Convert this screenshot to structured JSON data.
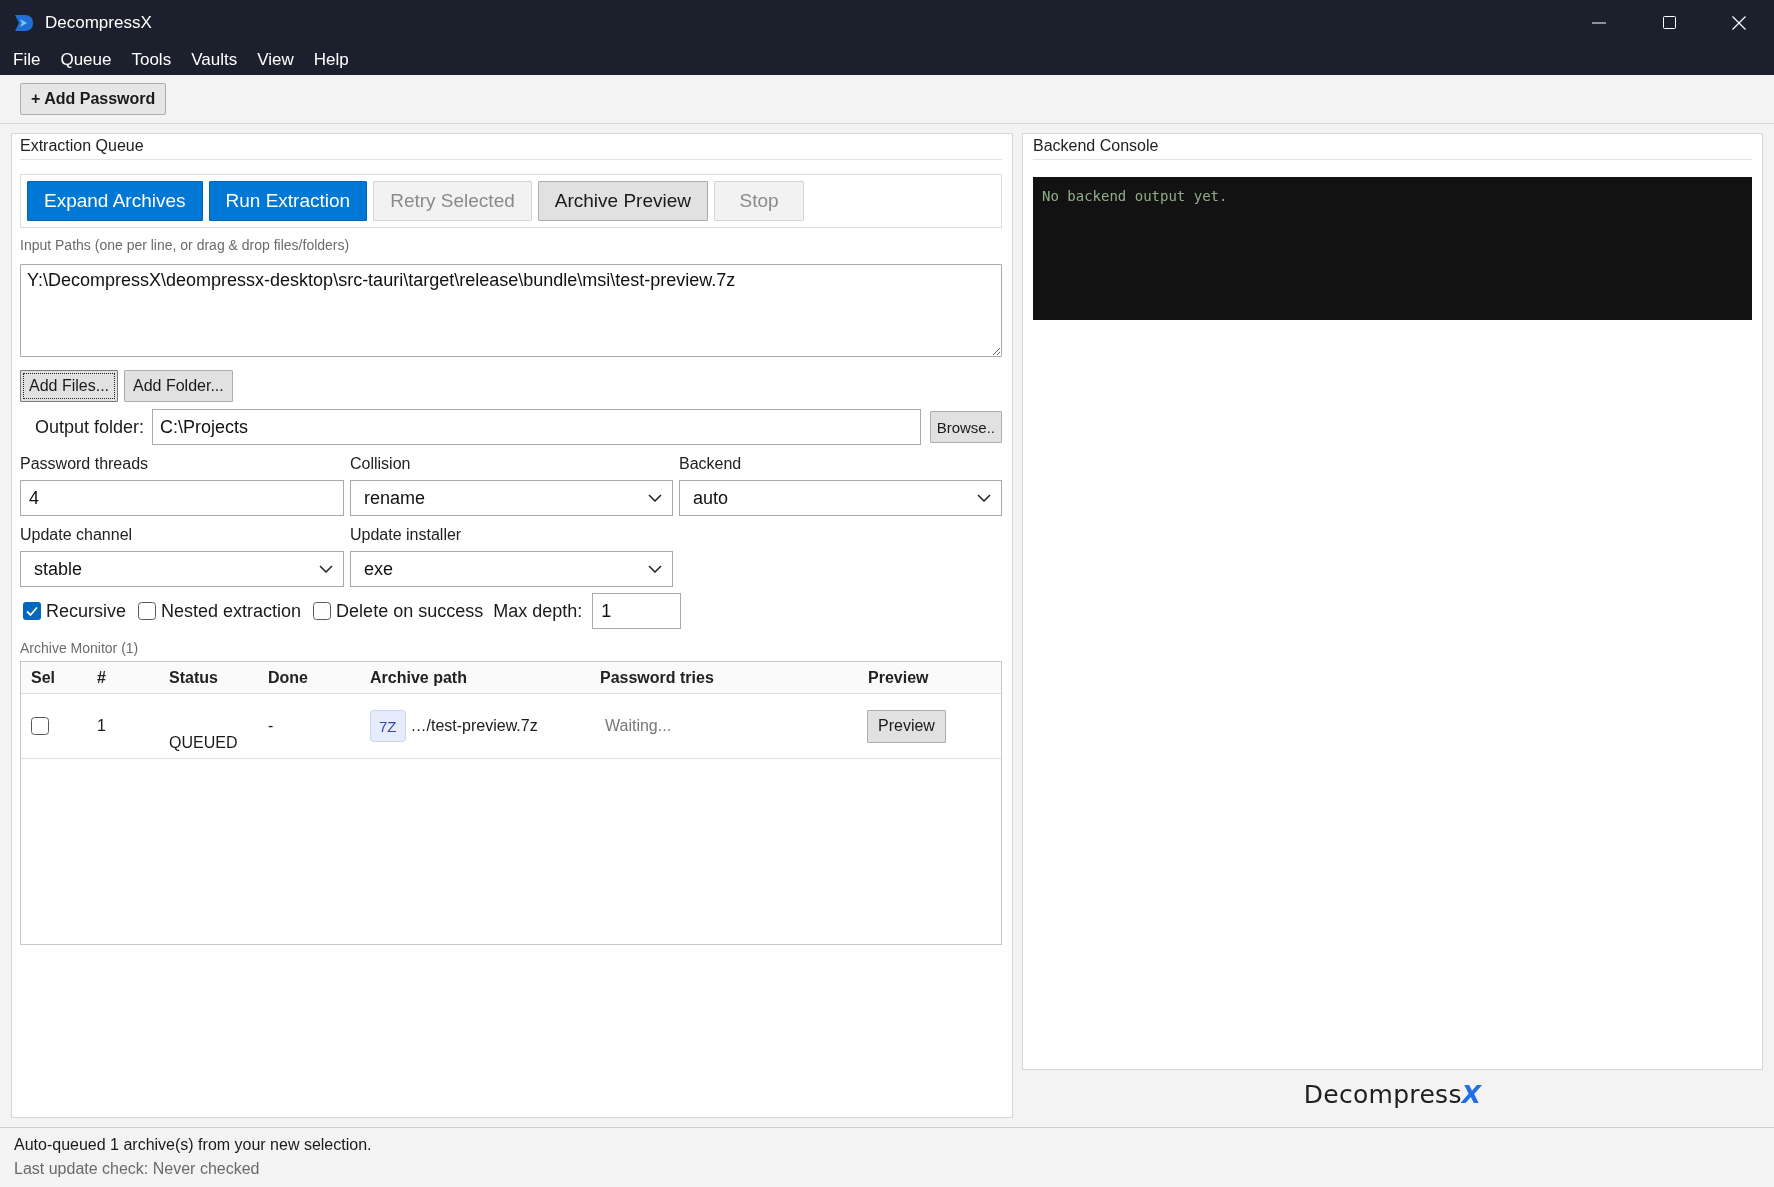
{
  "window": {
    "title": "DecompressX"
  },
  "menu": [
    "File",
    "Queue",
    "Tools",
    "Vaults",
    "View",
    "Help"
  ],
  "toolbar": [
    {
      "label": "+ Add Password"
    }
  ],
  "extraction_queue": {
    "title": "Extraction Queue",
    "actions": [
      {
        "label": "Expand Archives",
        "kind": "primary",
        "disabled": false
      },
      {
        "label": "Run Extraction",
        "kind": "primary",
        "disabled": false
      },
      {
        "label": "Retry Selected",
        "kind": "secondary",
        "disabled": true
      },
      {
        "label": "Archive Preview",
        "kind": "secondary",
        "disabled": false
      },
      {
        "label": "Stop",
        "kind": "secondary",
        "disabled": true
      }
    ],
    "input_paths": {
      "label": "Input Paths (one per line, or drag & drop files/folders)",
      "value": "Y:\\DecompressX\\deompressx-desktop\\src-tauri\\target\\release\\bundle\\msi\\test-preview.7z"
    },
    "add_buttons": [
      {
        "label": "Add Files...",
        "focused": true
      },
      {
        "label": "Add Folder...",
        "focused": false
      }
    ],
    "output_folder": {
      "label": "Output folder:",
      "value": "C:\\Projects",
      "browse": "Browse.."
    },
    "settings": [
      {
        "label": "Password threads",
        "value": "4",
        "kind": "text"
      },
      {
        "label": "Collision",
        "value": "rename",
        "kind": "select"
      },
      {
        "label": "Backend",
        "value": "auto",
        "kind": "select"
      },
      {
        "label": "Update channel",
        "value": "stable",
        "kind": "select"
      },
      {
        "label": "Update installer",
        "value": "exe",
        "kind": "select"
      }
    ],
    "options": [
      {
        "label": "Recursive",
        "checked": true
      },
      {
        "label": "Nested extraction",
        "checked": false
      },
      {
        "label": "Delete on success",
        "checked": false
      }
    ],
    "max_depth": {
      "label": "Max depth:",
      "value": "1"
    },
    "archive_monitor": {
      "title": "Archive Monitor (1)",
      "columns": [
        "Sel",
        "#",
        "Status",
        "Done",
        "Archive path",
        "Password tries",
        "Preview"
      ],
      "rows": [
        {
          "checked": false,
          "number": "1",
          "status": "QUEUED",
          "done": "-",
          "format": "7Z",
          "path": "…/test-preview.7z",
          "password_tries": "Waiting...",
          "preview": "Preview"
        }
      ]
    }
  },
  "backend_console": {
    "title": "Backend Console",
    "output": "No backend output yet."
  },
  "brand": {
    "name": "Decompress",
    "accent": "X"
  },
  "status_bar": [
    {
      "text": "Auto-queued 1 archive(s) from your new selection.",
      "kind": "message"
    },
    {
      "text": "Last update check: Never checked",
      "kind": "muted"
    }
  ]
}
